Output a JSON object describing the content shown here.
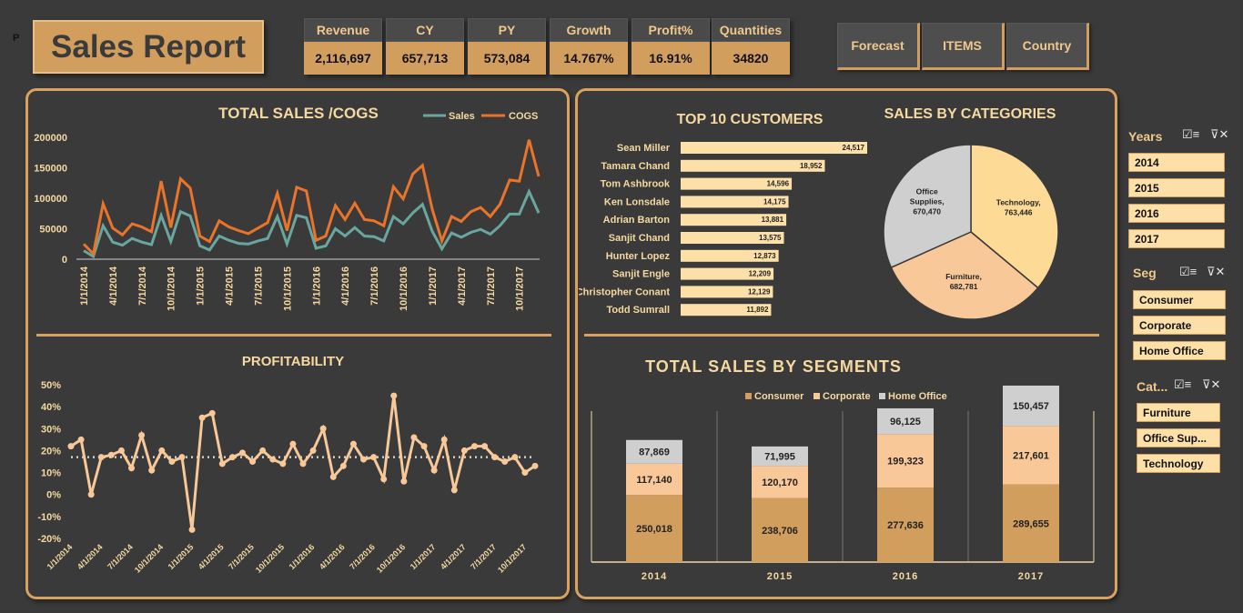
{
  "corner_label": "P",
  "title": "Sales Report",
  "kpis": [
    {
      "label": "Revenue",
      "value": "2,116,697"
    },
    {
      "label": "CY",
      "value": "657,713"
    },
    {
      "label": "PY",
      "value": "573,084"
    },
    {
      "label": "Growth",
      "value": "14.767%"
    },
    {
      "label": "Profit%",
      "value": "16.91%"
    },
    {
      "label": "Quantities",
      "value": "34820"
    }
  ],
  "nav_buttons": [
    "Forecast",
    "ITEMS",
    "Country"
  ],
  "slicers": {
    "years": {
      "title": "Years",
      "items": [
        "2014",
        "2015",
        "2016",
        "2017"
      ]
    },
    "seg": {
      "title": "Seg",
      "items": [
        "Consumer",
        "Corporate",
        "Home Office"
      ]
    },
    "cat": {
      "title": "Cat...",
      "items": [
        "Furniture",
        "Office Sup...",
        "Technology"
      ]
    }
  },
  "colors": {
    "accent": "#d9a25f",
    "sales": "#6aa6a0",
    "cogs": "#e9742a",
    "profit": "#f8c898",
    "bar": "#fce0a8",
    "consumer": "#d29e5d",
    "corporate": "#f8c898",
    "home_office": "#cfcfcf"
  },
  "chart_data": [
    {
      "type": "line",
      "title": "TOTAL SALES /COGS",
      "x_tick_labels": [
        "1/1/2014",
        "4/1/2014",
        "7/1/2014",
        "10/1/2014",
        "1/1/2015",
        "4/1/2015",
        "7/1/2015",
        "10/1/2015",
        "1/1/2016",
        "4/1/2016",
        "7/1/2016",
        "10/1/2016",
        "1/1/2017",
        "4/1/2017",
        "7/1/2017",
        "10/1/2017"
      ],
      "y_tick_labels": [
        "200000",
        "150000",
        "100000",
        "50000",
        "0"
      ],
      "ylim": [
        0,
        200000
      ],
      "series": [
        {
          "name": "Sales",
          "values": [
            14000,
            4500,
            55000,
            28000,
            23000,
            34000,
            28000,
            24000,
            72000,
            29000,
            78000,
            71000,
            22000,
            15000,
            38000,
            31000,
            26000,
            25000,
            30000,
            34000,
            70000,
            25000,
            72000,
            68000,
            18000,
            22000,
            50000,
            38000,
            52000,
            38000,
            37000,
            30000,
            70000,
            58000,
            76000,
            90000,
            46000,
            17000,
            43000,
            36000,
            44000,
            49000,
            41000,
            55000,
            74000,
            74000,
            111000,
            76000
          ]
        },
        {
          "name": "COGS",
          "values": [
            25000,
            9000,
            91000,
            51000,
            40000,
            58000,
            53000,
            45000,
            128000,
            52000,
            132000,
            117000,
            38000,
            29000,
            63000,
            53000,
            47000,
            42000,
            51000,
            60000,
            108000,
            47000,
            118000,
            112000,
            31000,
            38000,
            88000,
            65000,
            92000,
            65000,
            63000,
            55000,
            119000,
            99000,
            140000,
            154000,
            82000,
            30000,
            70000,
            62000,
            78000,
            85000,
            70000,
            90000,
            130000,
            128000,
            196000,
            136000
          ]
        }
      ]
    },
    {
      "type": "line",
      "title": "PROFITABILITY",
      "x_tick_labels": [
        "1/1/2014",
        "4/1/2014",
        "7/1/2014",
        "10/1/2014",
        "1/1/2015",
        "4/1/2015",
        "7/1/2015",
        "10/1/2015",
        "1/1/2016",
        "4/1/2016",
        "7/1/2016",
        "10/1/2016",
        "1/1/2017",
        "4/1/2017",
        "7/1/2017",
        "10/1/2017"
      ],
      "y_tick_labels": [
        "50%",
        "40%",
        "30%",
        "20%",
        "10%",
        "0%",
        "-10%",
        "-20%"
      ],
      "ylim": [
        -20,
        50
      ],
      "average": 17,
      "values": [
        22,
        25,
        0,
        17,
        18,
        20,
        12,
        27,
        11,
        20,
        15,
        17,
        -16,
        35,
        37,
        14,
        17,
        19,
        15,
        20,
        16,
        14,
        23,
        14,
        20,
        30,
        8,
        13,
        23,
        16,
        17,
        7,
        45,
        6,
        26,
        22,
        11,
        25,
        2,
        20,
        22,
        22,
        17,
        15,
        17,
        10,
        13
      ]
    },
    {
      "type": "bar",
      "orientation": "horizontal",
      "title": "TOP 10 CUSTOMERS",
      "categories": [
        "Sean Miller",
        "Tamara Chand",
        "Tom Ashbrook",
        "Ken Lonsdale",
        "Adrian Barton",
        "Sanjit Chand",
        "Hunter Lopez",
        "Sanjit Engle",
        "Christopher Conant",
        "Todd Sumrall"
      ],
      "values": [
        24517,
        18952,
        14596,
        14175,
        13881,
        13575,
        12873,
        12209,
        12129,
        11892
      ],
      "value_labels": [
        "24,517",
        "18,952",
        "14,596",
        "14,175",
        "13,881",
        "13,575",
        "12,873",
        "12,209",
        "12,129",
        "11,892"
      ]
    },
    {
      "type": "pie",
      "title": "SALES BY CATEGORIES",
      "slices": [
        {
          "name": "Technology",
          "value": 763446,
          "label": "Technology,",
          "value_label": "763,446"
        },
        {
          "name": "Furniture",
          "value": 682781,
          "label": "Furniture,",
          "value_label": "682,781"
        },
        {
          "name": "Office Supplies",
          "value": 670470,
          "label": "Office Supplies,",
          "value_label": "670,470"
        }
      ]
    },
    {
      "type": "bar",
      "stacked": true,
      "title": "TOTAL SALES BY SEGMENTS",
      "categories": [
        "2014",
        "2015",
        "2016",
        "2017"
      ],
      "series": [
        {
          "name": "Consumer",
          "values": [
            250018,
            238706,
            277636,
            289655
          ],
          "labels": [
            "250,018",
            "238,706",
            "277,636",
            "289,655"
          ]
        },
        {
          "name": "Corporate",
          "values": [
            117140,
            120170,
            199323,
            217601
          ],
          "labels": [
            "117,140",
            "120,170",
            "199,323",
            "217,601"
          ]
        },
        {
          "name": "Home Office",
          "values": [
            87869,
            71995,
            96125,
            150457
          ],
          "labels": [
            "87,869",
            "71,995",
            "96,125",
            "150,457"
          ]
        }
      ]
    }
  ]
}
